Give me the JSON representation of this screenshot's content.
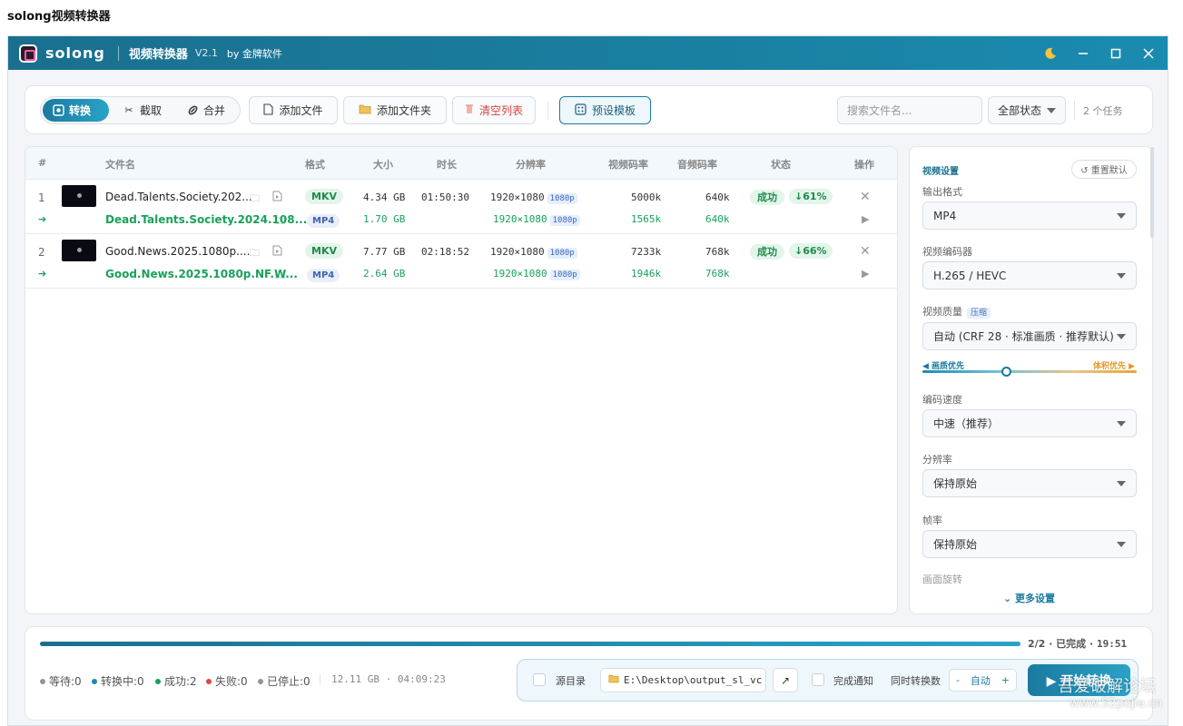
{
  "window_title": "solong视频转换器",
  "header": {
    "brand": "solong",
    "app_name": "视频转换器",
    "version": "V2.1",
    "byline": "by 金牌软件",
    "icons": [
      "moon-icon",
      "minimize-icon",
      "maximize-icon",
      "close-icon"
    ]
  },
  "toolbar": {
    "modes": [
      {
        "label": "转换",
        "icon": "convert-icon",
        "active": true
      },
      {
        "label": "截取",
        "icon": "scissors-icon",
        "active": false
      },
      {
        "label": "合并",
        "icon": "link-icon",
        "active": false
      }
    ],
    "add_file": "添加文件",
    "add_folder": "添加文件夹",
    "clear_list": "清空列表",
    "presets": "预设模板",
    "search_placeholder": "搜索文件名...",
    "status_filter": "全部状态",
    "task_count": "2 个任务"
  },
  "table": {
    "headers": [
      "#",
      "文件名",
      "格式",
      "大小",
      "时长",
      "分辨率",
      "视频码率",
      "音频码率",
      "状态",
      "操作"
    ],
    "rows": [
      {
        "index": "1",
        "source": {
          "name": "Dead.Talents.Society.202...",
          "format": "MKV",
          "size": "4.34 GB",
          "duration": "01:50:30",
          "resolution": "1920×1080",
          "res_badge": "1080p",
          "vbitrate": "5000k",
          "abitrate": "640k"
        },
        "output": {
          "name": "Dead.Talents.Society.2024.108...",
          "format": "MP4",
          "size": "1.70 GB",
          "resolution": "1920×1080",
          "res_badge": "1080p",
          "vbitrate": "1565k",
          "abitrate": "640k"
        },
        "status": "成功",
        "ratio": "↓61%"
      },
      {
        "index": "2",
        "source": {
          "name": "Good.News.2025.1080p....",
          "format": "MKV",
          "size": "7.77 GB",
          "duration": "02:18:52",
          "resolution": "1920×1080",
          "res_badge": "1080p",
          "vbitrate": "7233k",
          "abitrate": "768k"
        },
        "output": {
          "name": "Good.News.2025.1080p.NF.W...",
          "format": "MP4",
          "size": "2.64 GB",
          "resolution": "1920×1080",
          "res_badge": "1080p",
          "vbitrate": "1946k",
          "abitrate": "768k"
        },
        "status": "成功",
        "ratio": "↓66%"
      }
    ]
  },
  "settings": {
    "title": "视频设置",
    "reset": "↺ 重置默认",
    "output_format_label": "输出格式",
    "output_format": "MP4",
    "encoder_label": "视频编码器",
    "encoder": "H.265 / HEVC",
    "quality_label": "视频质量",
    "quality_tag": "压缩",
    "quality": "自动 (CRF 28 · 标准画质 · 推荐默认)",
    "slider_left": "◀ 画质优先",
    "slider_right": "体积优先 ▶",
    "slider_level": 0.39,
    "speed_label": "编码速度",
    "speed": "中速（推荐）",
    "resolution_label": "分辨率",
    "resolution": "保持原始",
    "framerate_label": "帧率",
    "framerate": "保持原始",
    "rotation_label": "画面旋转",
    "more": "⌄ 更多设置"
  },
  "bottom": {
    "progress": 1.0,
    "progress_count": "2/2",
    "progress_status": "已完成",
    "progress_time": "19:51",
    "stats": [
      {
        "label": "等待:0",
        "color": "#8a96a3"
      },
      {
        "label": "转换中:0",
        "color": "#1a8bb0"
      },
      {
        "label": "成功:2",
        "color": "#1aa05a"
      },
      {
        "label": "失败:0",
        "color": "#e0473d"
      },
      {
        "label": "已停止:0",
        "color": "#8a96a3"
      }
    ],
    "totals": "12.11 GB · 04:09:23",
    "source_dir_label": "源目录",
    "output_path": "E:\\Desktop\\output_sl_vc",
    "notify_label": "完成通知",
    "concurrency_label": "同时转换数",
    "concurrency_value": "自动",
    "start": "▶ 开始转换"
  },
  "watermark": {
    "line1": "吾爱破解论坛",
    "line2": "www.52pojie.cn"
  }
}
